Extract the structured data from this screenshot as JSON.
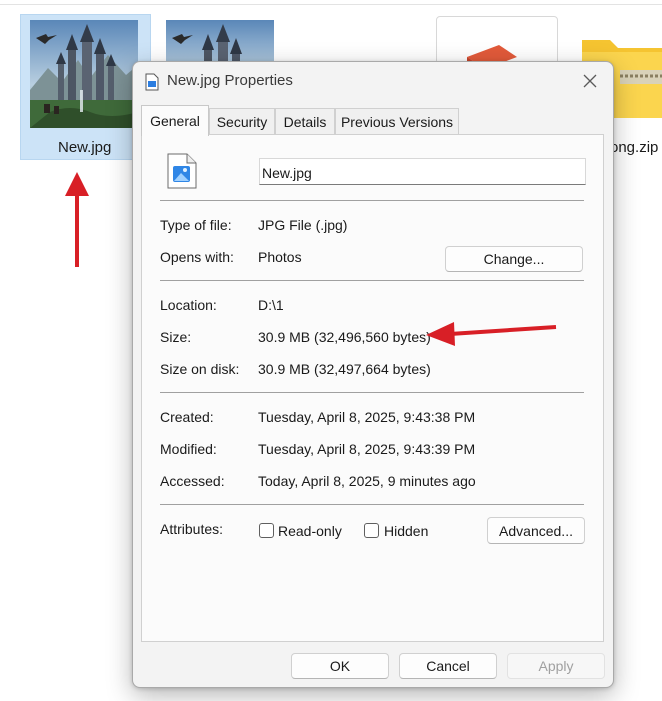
{
  "explorer": {
    "files": [
      {
        "label": "New.jpg"
      },
      {
        "label": ""
      },
      {
        "label": ""
      },
      {
        "label": "ong.zip"
      }
    ]
  },
  "dialog": {
    "title": "New.jpg Properties",
    "tabs": [
      "General",
      "Security",
      "Details",
      "Previous Versions"
    ],
    "file_name_value": "New.jpg",
    "type_label": "Type of file:",
    "type_value": "JPG File (.jpg)",
    "opens_label": "Opens with:",
    "opens_value": "Photos",
    "change_button": "Change...",
    "location_label": "Location:",
    "location_value": "D:\\1",
    "size_label": "Size:",
    "size_value": "30.9 MB (32,496,560 bytes)",
    "size_disk_label": "Size on disk:",
    "size_disk_value": "30.9 MB (32,497,664 bytes)",
    "created_label": "Created:",
    "created_value": "Tuesday, April 8, 2025, 9:43:38 PM",
    "modified_label": "Modified:",
    "modified_value": "Tuesday, April 8, 2025, 9:43:39 PM",
    "accessed_label": "Accessed:",
    "accessed_value": "Today, April 8, 2025, 9 minutes ago",
    "attributes_label": "Attributes:",
    "readonly_label": "Read-only",
    "hidden_label": "Hidden",
    "advanced_button": "Advanced...",
    "ok_button": "OK",
    "cancel_button": "Cancel",
    "apply_button": "Apply"
  },
  "colors": {
    "annotation_arrow": "#d81f26",
    "selection": "#cce3f7",
    "folder_yellow": "#f5c431"
  }
}
